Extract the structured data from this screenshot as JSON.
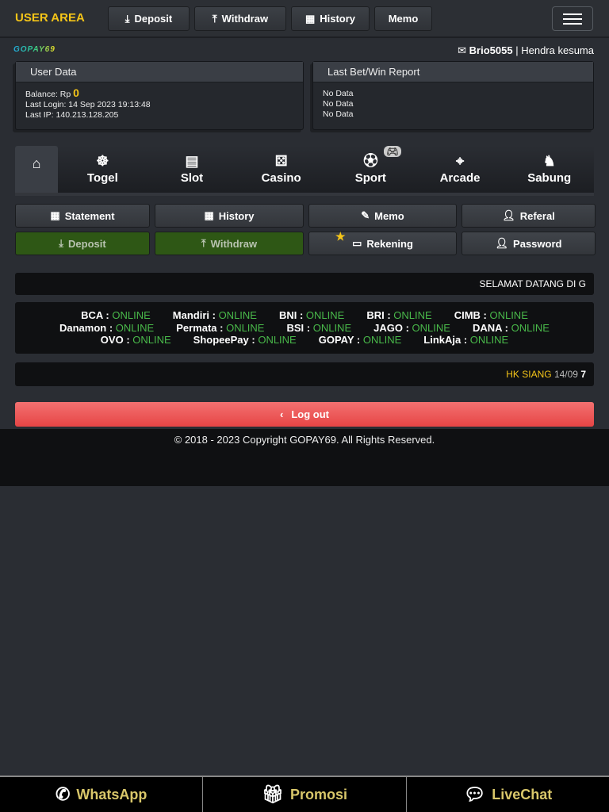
{
  "header": {
    "brand": "USER AREA",
    "buttons": [
      {
        "label": "Deposit",
        "icon": "deposit-icon"
      },
      {
        "label": "Withdraw",
        "icon": "withdraw-icon"
      },
      {
        "label": "History",
        "icon": "calendar-icon"
      },
      {
        "label": "Memo"
      }
    ]
  },
  "logo": "GOPAY69",
  "user": {
    "username": "Brio5055",
    "separator": "|",
    "fullname": "Hendra kesuma"
  },
  "user_data": {
    "title": "User Data",
    "balance_label": "Balance: Rp",
    "balance": "0",
    "last_login": "Last Login: 14 Sep 2023 19:13:48",
    "last_ip": "Last IP: 140.213.128.205"
  },
  "report": {
    "title": "Last Bet/Win Report",
    "rows": [
      "No Data",
      "No Data",
      "No Data"
    ]
  },
  "tabs": [
    "Togel",
    "Slot",
    "Casino",
    "Sport",
    "Arcade",
    "Sabung"
  ],
  "grid": [
    "Statement",
    "History",
    "Memo",
    "Referal",
    "Deposit",
    "Withdraw",
    "Rekening",
    "Password"
  ],
  "ticker1": "SELAMAT DATANG DI G",
  "banks": [
    [
      [
        "BCA",
        "ONLINE"
      ],
      [
        "Mandiri",
        "ONLINE"
      ],
      [
        "BNI",
        "ONLINE"
      ],
      [
        "BRI",
        "ONLINE"
      ],
      [
        "CIMB",
        "ONLINE"
      ]
    ],
    [
      [
        "Danamon",
        "ONLINE"
      ],
      [
        "Permata",
        "ONLINE"
      ],
      [
        "BSI",
        "ONLINE"
      ],
      [
        "JAGO",
        "ONLINE"
      ],
      [
        "DANA",
        "ONLINE"
      ]
    ],
    [
      [
        "OVO",
        "ONLINE"
      ],
      [
        "ShopeePay",
        "ONLINE"
      ],
      [
        "GOPAY",
        "ONLINE"
      ],
      [
        "LinkAja",
        "ONLINE"
      ]
    ]
  ],
  "ticker2": {
    "market": "HK SIANG",
    "date": "14/09",
    "result": "7"
  },
  "logout": "Log out",
  "footer": "© 2018 - 2023 Copyright GOPAY69. All Rights Reserved.",
  "bottom": [
    "WhatsApp",
    "Promosi",
    "LiveChat"
  ],
  "colors": {
    "accent": "#f5c518",
    "online": "#49b94a",
    "logout": "#e64545",
    "bottom_text": "#d9c76a"
  }
}
